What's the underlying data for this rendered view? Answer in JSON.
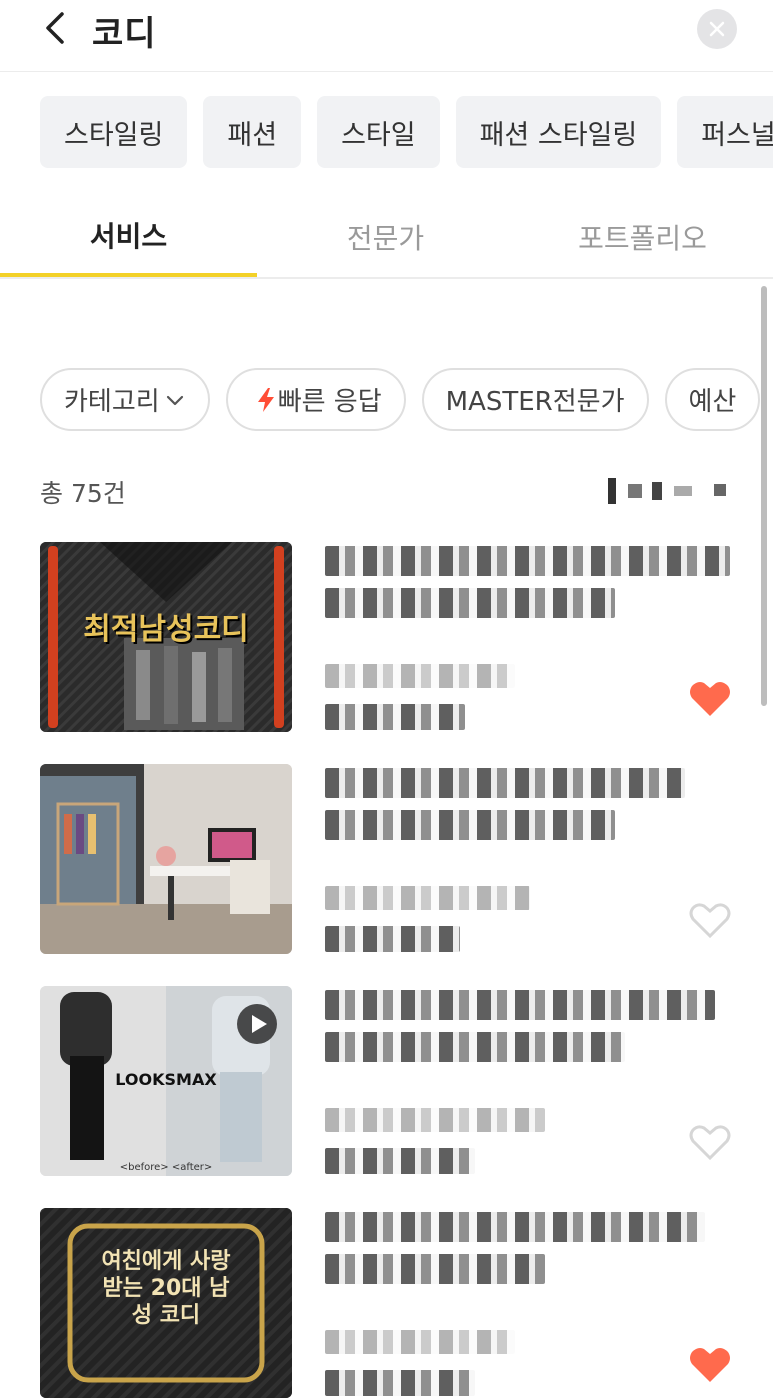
{
  "header": {
    "title": "코디"
  },
  "keywords": [
    "스타일링",
    "패션",
    "스타일",
    "패션 스타일링",
    "퍼스널"
  ],
  "tabs": [
    {
      "label": "서비스",
      "active": true
    },
    {
      "label": "전문가",
      "active": false
    },
    {
      "label": "포트폴리오",
      "active": false
    }
  ],
  "filters": {
    "category": "카테고리",
    "quick_response": "빠른 응답",
    "master": "MASTER전문가",
    "budget": "예산"
  },
  "results": {
    "total": "총 75건"
  },
  "items": [
    {
      "thumb_text": "최적남성코디",
      "liked": true
    },
    {
      "thumb_text": "",
      "liked": false
    },
    {
      "thumb_text": "LOOKSMAX",
      "thumb_caption": "<before> <after>",
      "liked": false
    },
    {
      "thumb_text": "여친에게 사랑받는 20대 남성 코디",
      "liked": true
    }
  ],
  "colors": {
    "accent": "#f3d128",
    "heart": "#ff6a4d",
    "bolt": "#ff4d36"
  }
}
